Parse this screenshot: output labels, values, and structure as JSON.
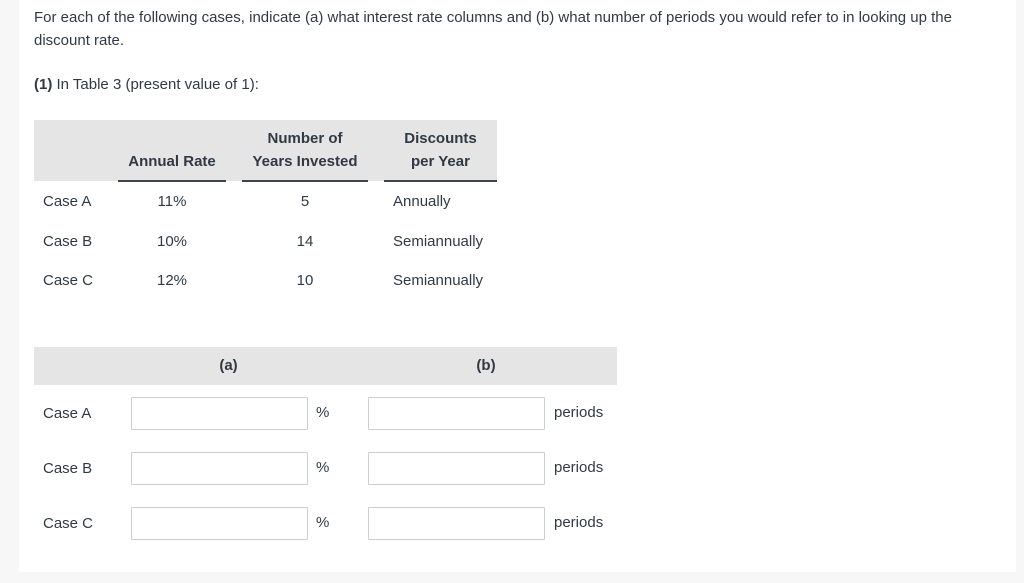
{
  "question": {
    "intro": "For each of the following cases, indicate (a) what interest rate columns and (b) what number of periods you would refer to in looking up the discount rate.",
    "part_number": "(1)",
    "part_text": " In Table 3 (present value of 1):"
  },
  "given_table": {
    "headers": [
      {
        "line1": "",
        "line2": "Annual Rate"
      },
      {
        "line1": "Number of",
        "line2": "Years Invested"
      },
      {
        "line1": "Discounts",
        "line2": "per Year"
      }
    ],
    "rows": [
      {
        "case": "Case A",
        "annual_rate": "11%",
        "years": "5",
        "discounts": "Annually"
      },
      {
        "case": "Case B",
        "annual_rate": "10%",
        "years": "14",
        "discounts": "Semiannually"
      },
      {
        "case": "Case C",
        "annual_rate": "12%",
        "years": "10",
        "discounts": "Semiannually"
      }
    ]
  },
  "answer_table": {
    "headers": {
      "a": "(a)",
      "b": "(b)"
    },
    "rows": [
      {
        "case": "Case A",
        "rate_value": "",
        "rate_unit": "%",
        "periods_value": "",
        "periods_unit": "periods"
      },
      {
        "case": "Case B",
        "rate_value": "",
        "rate_unit": "%",
        "periods_value": "",
        "periods_unit": "periods"
      },
      {
        "case": "Case C",
        "rate_value": "",
        "rate_unit": "%",
        "periods_value": "",
        "periods_unit": "periods"
      }
    ]
  }
}
